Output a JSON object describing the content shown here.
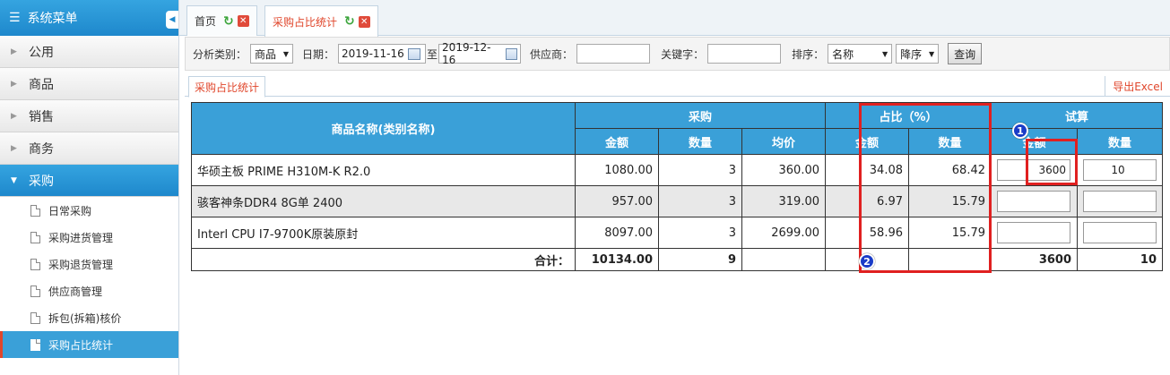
{
  "sidebar": {
    "title": "系统菜单",
    "menu": [
      {
        "label": "公用",
        "open": false
      },
      {
        "label": "商品",
        "open": false
      },
      {
        "label": "销售",
        "open": false
      },
      {
        "label": "商务",
        "open": false
      },
      {
        "label": "采购",
        "open": true
      }
    ],
    "sub_items": [
      "日常采购",
      "采购进货管理",
      "采购退货管理",
      "供应商管理",
      "拆包(拆箱)核价",
      "采购占比统计"
    ]
  },
  "tabs": [
    {
      "label": "首页"
    },
    {
      "label": "采购占比统计"
    }
  ],
  "filters": {
    "category_label": "分析类别：",
    "category_value": "商品",
    "date_label": "日期：",
    "date_from": "2019-11-16",
    "to_label": "至",
    "date_to": "2019-12-16",
    "supplier_label": "供应商：",
    "keyword_label": "关键字：",
    "sort_label": "排序：",
    "sort_value": "名称",
    "order_value": "降序",
    "query_button": "查询"
  },
  "subtab": {
    "label": "采购占比统计",
    "export": "导出Excel"
  },
  "table": {
    "headers": {
      "name": "商品名称(类别名称)",
      "purchase": "采购",
      "ratio": "占比（%）",
      "trial": "试算",
      "amount": "金额",
      "quantity": "数量",
      "avg": "均价",
      "ratio_amount": "金额",
      "ratio_quantity": "数量",
      "trial_amount": "金额",
      "trial_quantity": "数量"
    },
    "rows": [
      {
        "name": "华硕主板 PRIME H310M-K R2.0",
        "amount": "1080.00",
        "qty": "3",
        "avg": "360.00",
        "ratio_amount": "34.08",
        "ratio_qty": "68.42",
        "trial_amount": "3600",
        "trial_qty": "10"
      },
      {
        "name": "骇客神条DDR4 8G单 2400",
        "amount": "957.00",
        "qty": "3",
        "avg": "319.00",
        "ratio_amount": "6.97",
        "ratio_qty": "15.79",
        "trial_amount": "",
        "trial_qty": ""
      },
      {
        "name": "Interl CPU I7-9700K原装原封",
        "amount": "8097.00",
        "qty": "3",
        "avg": "2699.00",
        "ratio_amount": "58.96",
        "ratio_qty": "15.79",
        "trial_amount": "",
        "trial_qty": ""
      }
    ],
    "total": {
      "label": "合计：",
      "amount": "10134.00",
      "qty": "9",
      "trial_amount": "3600",
      "trial_qty": "10"
    }
  },
  "annotations": {
    "badge1": "1",
    "badge2": "2",
    "color": "#e02020"
  }
}
